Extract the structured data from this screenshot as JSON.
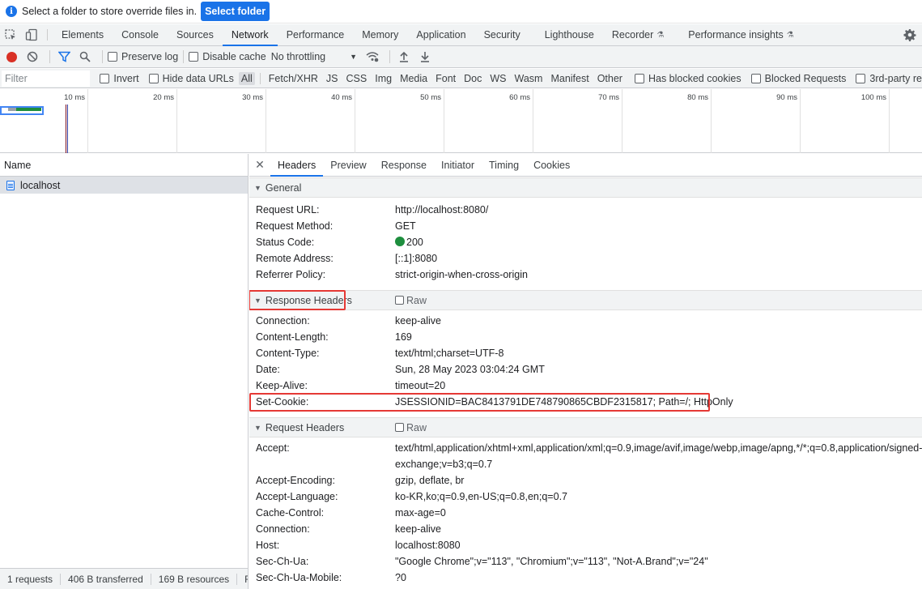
{
  "infobar": {
    "icon": "info-icon",
    "message": "Select a folder to store override files in.",
    "button": "Select folder"
  },
  "main_tabs": [
    "Elements",
    "Console",
    "Sources",
    "Network",
    "Performance",
    "Memory",
    "Application",
    "Security",
    "Lighthouse",
    "Recorder",
    "Performance insights"
  ],
  "active_main_tab": "Network",
  "toolbar": {
    "preserve_log": "Preserve log",
    "disable_cache": "Disable cache",
    "throttling": "No throttling"
  },
  "filter": {
    "placeholder": "Filter",
    "invert": "Invert",
    "hide_data_urls": "Hide data URLs",
    "types": [
      "All",
      "Fetch/XHR",
      "JS",
      "CSS",
      "Img",
      "Media",
      "Font",
      "Doc",
      "WS",
      "Wasm",
      "Manifest",
      "Other"
    ],
    "active_type": "All",
    "has_blocked_cookies": "Has blocked cookies",
    "blocked_requests": "Blocked Requests",
    "third_party": "3rd-party re"
  },
  "timeline": {
    "ticks": [
      "10 ms",
      "20 ms",
      "30 ms",
      "40 ms",
      "50 ms",
      "60 ms",
      "70 ms",
      "80 ms",
      "90 ms",
      "100 ms"
    ]
  },
  "requests": {
    "column": "Name",
    "items": [
      {
        "name": "localhost"
      }
    ]
  },
  "statusbar": {
    "requests": "1 requests",
    "transferred": "406 B transferred",
    "resources": "169 B resources",
    "finish": "Fi"
  },
  "detail_tabs": [
    "Headers",
    "Preview",
    "Response",
    "Initiator",
    "Timing",
    "Cookies"
  ],
  "active_detail_tab": "Headers",
  "general": {
    "title": "General",
    "rows": [
      {
        "k": "Request URL:",
        "v": "http://localhost:8080/"
      },
      {
        "k": "Request Method:",
        "v": "GET"
      },
      {
        "k": "Status Code:",
        "v": "200"
      },
      {
        "k": "Remote Address:",
        "v": "[::1]:8080"
      },
      {
        "k": "Referrer Policy:",
        "v": "strict-origin-when-cross-origin"
      }
    ]
  },
  "response_headers": {
    "title": "Response Headers",
    "raw": "Raw",
    "rows": [
      {
        "k": "Connection:",
        "v": "keep-alive"
      },
      {
        "k": "Content-Length:",
        "v": "169"
      },
      {
        "k": "Content-Type:",
        "v": "text/html;charset=UTF-8"
      },
      {
        "k": "Date:",
        "v": "Sun, 28 May 2023 03:04:24 GMT"
      },
      {
        "k": "Keep-Alive:",
        "v": "timeout=20"
      },
      {
        "k": "Set-Cookie:",
        "v": "JSESSIONID=BAC8413791DE748790865CBDF2315817; Path=/; HttpOnly"
      }
    ]
  },
  "request_headers": {
    "title": "Request Headers",
    "raw": "Raw",
    "rows": [
      {
        "k": "Accept:",
        "v": "text/html,application/xhtml+xml,application/xml;q=0.9,image/avif,image/webp,image/apng,*/*;q=0.8,application/signed-exchange;v=b3;q=0.7"
      },
      {
        "k": "Accept-Encoding:",
        "v": "gzip, deflate, br"
      },
      {
        "k": "Accept-Language:",
        "v": "ko-KR,ko;q=0.9,en-US;q=0.8,en;q=0.7"
      },
      {
        "k": "Cache-Control:",
        "v": "max-age=0"
      },
      {
        "k": "Connection:",
        "v": "keep-alive"
      },
      {
        "k": "Host:",
        "v": "localhost:8080"
      },
      {
        "k": "Sec-Ch-Ua:",
        "v": "\"Google Chrome\";v=\"113\", \"Chromium\";v=\"113\", \"Not-A.Brand\";v=\"24\""
      },
      {
        "k": "Sec-Ch-Ua-Mobile:",
        "v": "?0"
      }
    ]
  },
  "colors": {
    "accent": "#1a73e8",
    "highlight": "#e53935",
    "status_ok": "#1e8e3e",
    "record": "#d93025"
  }
}
